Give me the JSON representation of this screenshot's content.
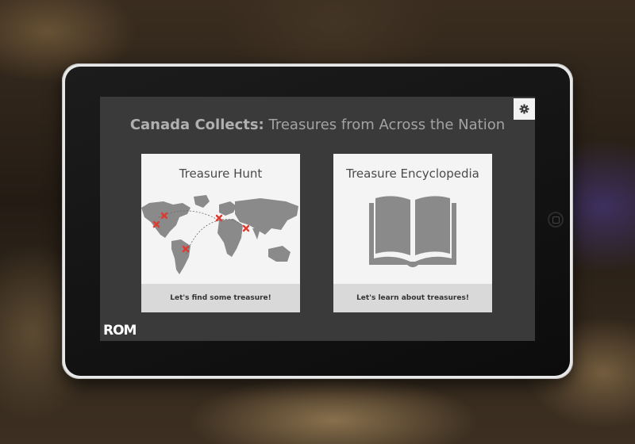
{
  "app": {
    "title_bold": "Canada Collects:",
    "title_rest": " Treasures from Across the Nation",
    "settings_icon": "gear-icon",
    "logo": "ROM"
  },
  "cards": [
    {
      "title": "Treasure Hunt",
      "action": "Let's find some treasure!",
      "icon": "world-map-icon"
    },
    {
      "title": "Treasure Encyclopedia",
      "action": "Let's learn about treasures!",
      "icon": "open-book-icon"
    }
  ],
  "colors": {
    "marker": "#e03a2f",
    "card_bg": "#f4f4f4",
    "footer_bg": "#d9d9d9",
    "screen_bg": "#3a3a3a"
  }
}
